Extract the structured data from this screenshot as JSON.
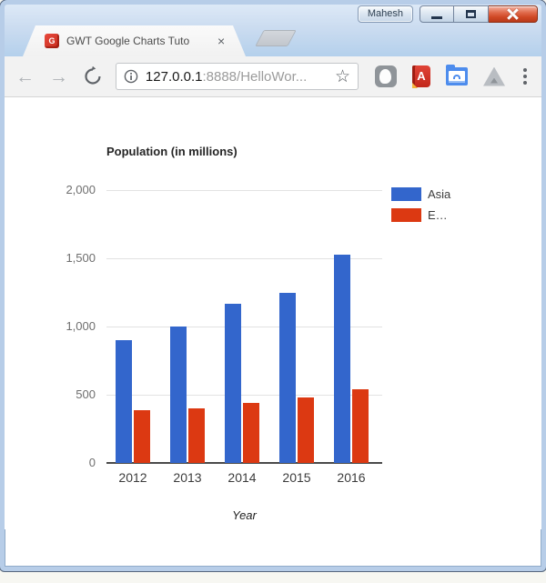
{
  "window": {
    "user_button_label": "Mahesh"
  },
  "tab": {
    "title": "GWT Google Charts Tuto",
    "close_glyph": "×"
  },
  "toolbar": {
    "url": {
      "host": "127.0.0.1",
      "path": ":8888/HelloWor..."
    }
  },
  "icons": {
    "back_arrow": "←",
    "forward_arrow": "→",
    "star": "☆",
    "ext_book_letter": "A"
  },
  "chart_data": {
    "type": "bar",
    "title": "Population (in millions)",
    "xlabel": "Year",
    "categories": [
      "2012",
      "2013",
      "2014",
      "2015",
      "2016"
    ],
    "series": [
      {
        "name": "Asia",
        "legend_label": "Asia",
        "color": "#3366CC",
        "values": [
          900,
          1000,
          1170,
          1250,
          1530
        ]
      },
      {
        "name": "Europe",
        "legend_label": "E…",
        "color": "#DC3912",
        "values": [
          390,
          400,
          440,
          480,
          540
        ]
      }
    ],
    "ylim": [
      0,
      2000
    ],
    "yticks": [
      0,
      500,
      1000,
      1500,
      2000
    ],
    "ytick_labels": [
      "0",
      "500",
      "1,000",
      "1,500",
      "2,000"
    ],
    "grid": true,
    "legend_position": "right"
  }
}
